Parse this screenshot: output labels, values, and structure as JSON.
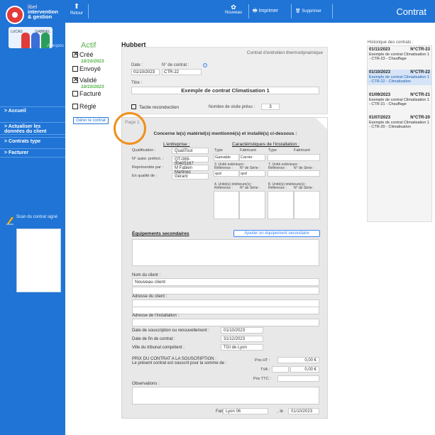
{
  "app": {
    "logo_line1": "libel",
    "logo_line2": "intervention",
    "logo_line3": "& gestion",
    "team_left": "LUCAS",
    "team_right": "GABRIEL",
    "about": "A propos"
  },
  "sidebar": {
    "accueil": "> Accueil",
    "actualiser": "> Actualiser les données du client",
    "contrats_type": "> Contrats type",
    "facturer": "> Facturer",
    "scan_label": "Scan du contrat signé"
  },
  "toolbar": {
    "back": "Retour",
    "new": "Nouveau",
    "print": "Imprimer",
    "delete": "Supprimer",
    "title": "Contrat"
  },
  "status": {
    "title": "Actif",
    "cree_label": "Créé",
    "cree_date": "18/10/2023",
    "envoye_label": "Envoyé",
    "valide_label": "Validé",
    "valide_date": "18/10/2023",
    "facture_label": "Facturé",
    "regle_label": "Réglé",
    "manage_button": "Gérer le contrat"
  },
  "client": {
    "name": "Hubbert"
  },
  "contract": {
    "type_label": "Contrat d'entretien thermodynamique",
    "date_label": "Date :",
    "date_value": "01/10/2023",
    "number_label": "N° de contrat :",
    "number_value": "CTR-22",
    "title_label": "Titre :",
    "title_value": "Exemple de contrat Climatisation 1",
    "tacite_label": "Tacite reconduction",
    "visits_label": "Nombre de visite prévu :",
    "visits_value": "3"
  },
  "page1": {
    "page_label": "Page 1",
    "section_title": "Concerne le(s) matériel(s) mentionné(s) et installé(s) ci-dessous :",
    "company_title": "L'entreprise :",
    "qualification_label": "Qualification :",
    "qualification_value": "QualiTout",
    "prefect_label": "N° autor. préfect. :",
    "prefect_value": "QT-069-00405167",
    "rep_label": "Représentée par :",
    "rep_value": "M Fabien Martinez",
    "quality_label": "En qualité de :",
    "quality_value": "Gérant",
    "install_title": "Caractéristiques de l'installation :",
    "col_type": "Type",
    "col_fabricant": "Fabricant",
    "col_type2": "Type",
    "col_fabricant2": "Fabricant",
    "type1_value": "Gainable",
    "fab1_value": "Carrier",
    "unit3": "3. Unité extérieure :",
    "unit7": "7. Unité extérieure :",
    "ref_label": "Référence :",
    "serial_label": "N° de Série :",
    "ref3_value": "qsd",
    "serial3_value": "qsd",
    "unit4": "4. Unité(s) intérieure(s) :",
    "unit8": "8. Unité(s) intérieure(s) :",
    "equip_title": "Équipements secondaires",
    "equip_button": "Ajouter un équipement secondaire",
    "client_name_label": "Nom du client :",
    "client_name_value": "Nouveau client",
    "client_addr_label": "Adresse du client :",
    "install_addr_label": "Adresse de l'installation :",
    "sub_date_label": "Date de souscription ou renouvellement :",
    "sub_date_value": "01/10/2023",
    "end_date_label": "Date de fin de contrat :",
    "end_date_value": "31/12/2023",
    "court_label": "Ville du tribunal compétent :",
    "court_value": "TGI de Lyon",
    "price_title": "PRIX DU CONTRAT A LA SOUSCRIPTION :",
    "price_sub": "Le présent contrat est souscrit pour la somme de :",
    "price_ht_label": "Prix HT :",
    "price_ht_value": "0,00 €",
    "tva_label": "TVA :",
    "tva_value": "0,00 €",
    "ttc_label": "Prix TTC :",
    "obs_label": "Observations :",
    "fait_label": "Fait à",
    "fait_value": "Lyon 06",
    "le_label": ", le",
    "le_value": "01/10/2023"
  },
  "history": {
    "title": "Historique des contrats :",
    "items": [
      {
        "date": "01/11/2023",
        "num": "N°CTR-23",
        "text": "Exemple de contrat Climatisation 1 - CTR-23 - Chauffage"
      },
      {
        "date": "01/10/2023",
        "num": "N°CTR-22",
        "text": "Exemple de contrat Climatisation 1 - CTR-22 - Climatisation"
      },
      {
        "date": "01/09/2023",
        "num": "N°CTR-21",
        "text": "Exemple de contrat Climatisation 1 - CTR-21 - Chauffage"
      },
      {
        "date": "01/07/2023",
        "num": "N°CTR-20",
        "text": "Exemple de contrat Climatisation 1 - CTR-20 - Climatisation"
      }
    ]
  },
  "colors": {
    "brand_blue": "#1f74d6",
    "active_green": "#55b34a",
    "highlight_orange": "#f0901c"
  }
}
